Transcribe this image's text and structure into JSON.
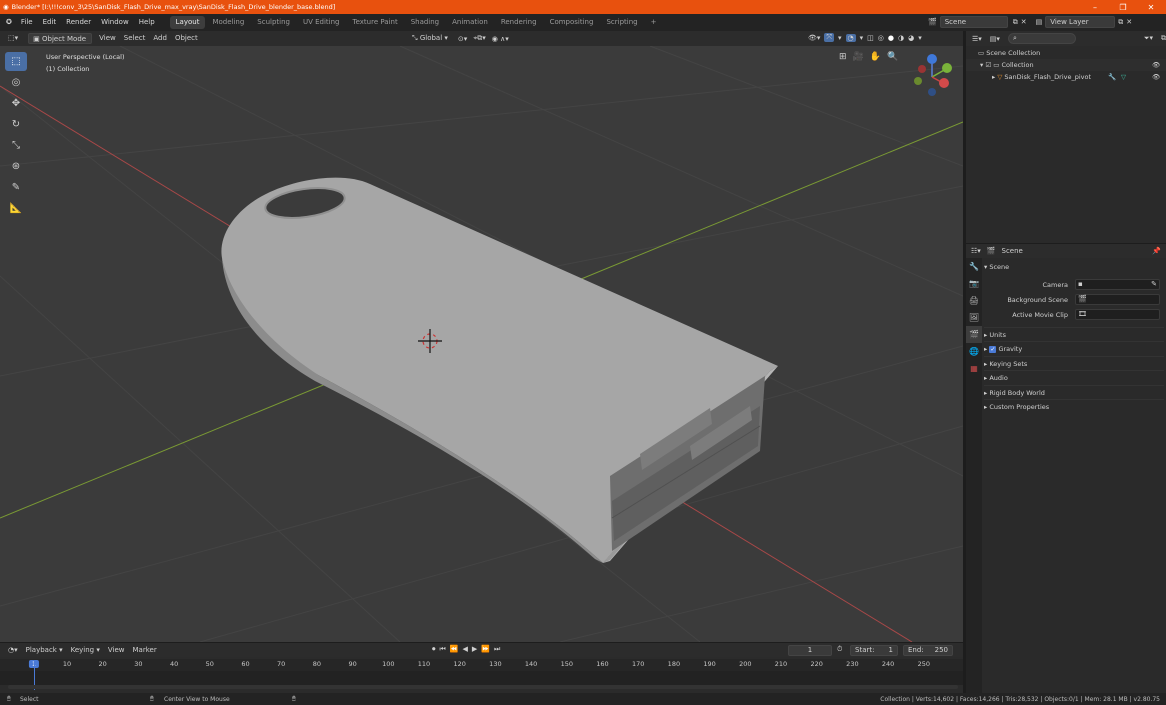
{
  "title_bar": {
    "title": "Blender* [I:\\!!!conv_3\\25\\SanDisk_Flash_Drive_max_vray\\SanDisk_Flash_Drive_blender_base.blend]",
    "minimize": "–",
    "maximize": "❐",
    "close": "✕"
  },
  "menu": {
    "items": [
      "File",
      "Edit",
      "Render",
      "Window",
      "Help"
    ],
    "workspaces": [
      "Layout",
      "Modeling",
      "Sculpting",
      "UV Editing",
      "Texture Paint",
      "Shading",
      "Animation",
      "Rendering",
      "Compositing",
      "Scripting"
    ],
    "add_workspace": "+",
    "scene": "Scene",
    "view_layer": "View Layer"
  },
  "viewport_header": {
    "mode": "Object Mode",
    "view": "View",
    "select": "Select",
    "add": "Add",
    "object": "Object",
    "orientation": "Global"
  },
  "viewport": {
    "perspective": "User Perspective (Local)",
    "collection": "(1) Collection"
  },
  "outliner": {
    "root": "Scene Collection",
    "collection": "Collection",
    "object": "SanDisk_Flash_Drive_pivot"
  },
  "properties": {
    "context": "Scene",
    "panel": "Scene",
    "camera_label": "Camera",
    "background_label": "Background Scene",
    "clip_label": "Active Movie Clip",
    "sections": [
      "Units",
      "Gravity",
      "Keying Sets",
      "Audio",
      "Rigid Body World",
      "Custom Properties"
    ],
    "gravity_checked": true
  },
  "timeline": {
    "menus": [
      "Playback",
      "Keying",
      "View",
      "Marker"
    ],
    "current_frame": "1",
    "start_label": "Start:",
    "start": "1",
    "end_label": "End:",
    "end": "250",
    "ticks": [
      "1",
      "10",
      "20",
      "30",
      "40",
      "50",
      "60",
      "70",
      "80",
      "90",
      "100",
      "110",
      "120",
      "130",
      "140",
      "150",
      "160",
      "170",
      "180",
      "190",
      "200",
      "210",
      "220",
      "230",
      "240",
      "250"
    ]
  },
  "status": {
    "select": "Select",
    "center": "Center View to Mouse",
    "stats": "Collection | Verts:14,602 | Faces:14,266 | Tris:28,532 | Objects:0/1 | Mem: 28.1 MB | v2.80.75"
  },
  "colors": {
    "accent": "#e8510e",
    "active_blue": "#4a6fa5",
    "axis_x": "#c44b4b",
    "axis_y": "#8bb53a"
  }
}
